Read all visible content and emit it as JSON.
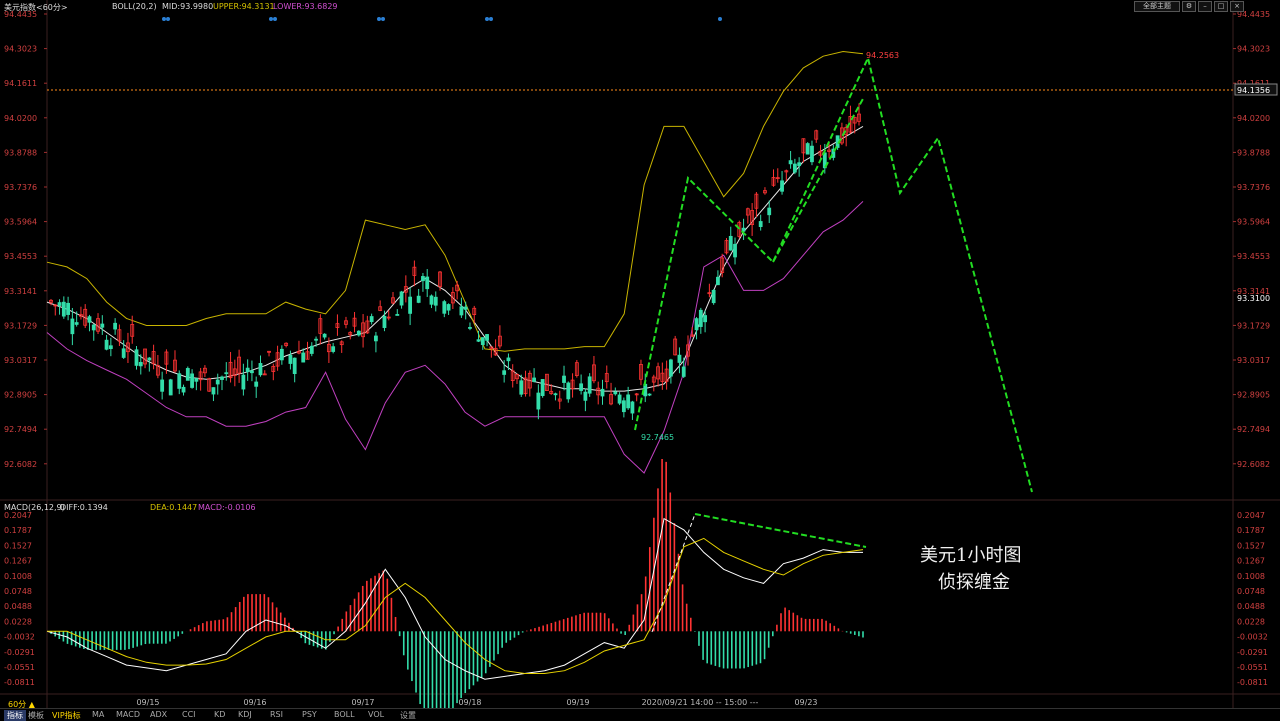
{
  "header": {
    "symbol": "美元指数<60分>",
    "boll": "BOLL(20,2)",
    "mid": "MID:93.9980",
    "upper": "UPPER:94.3131",
    "lower": "LOWER:93.6829",
    "macd": "MACD(26,12,9)",
    "diff": "DIFF:0.1394",
    "dea": "DEA:0.1447",
    "macd_val": "MACD:-0.0106",
    "main_menu": "全部主题"
  },
  "colors": {
    "up": "#ff3333",
    "down": "#33ddaa",
    "mid": "#e8e8e8",
    "upper": "#c8b400",
    "lower": "#c040c0",
    "diff": "#ffffff",
    "dea": "#e6d200",
    "forecast": "#22dd22",
    "price_label": "#ff4040",
    "current_price": "#ff8c1a"
  },
  "price_axis": [
    "94.4435",
    "94.3023",
    "94.1611",
    "94.0200",
    "93.8788",
    "93.7376",
    "93.5964",
    "93.4553",
    "93.3141",
    "93.1729",
    "93.0317",
    "92.8905",
    "92.7494",
    "92.6082"
  ],
  "macd_axis": [
    "0.2047",
    "0.1787",
    "0.1527",
    "0.1267",
    "0.1008",
    "0.0748",
    "0.0488",
    "0.0228",
    "-0.0032",
    "-0.0291",
    "-0.0551",
    "-0.0811"
  ],
  "current_price": "94.1356",
  "right_price_label": "93.3100",
  "high_label": "94.2563",
  "low_label": "92.7465",
  "dates": [
    "09/15",
    "09/16",
    "09/17",
    "09/18",
    "09/19",
    "2020/09/21 14:00 -- 15:00 ---",
    "09/23"
  ],
  "annotation": {
    "line1": "美元1小时图",
    "line2": "侦探缠金"
  },
  "bottom_tabs": [
    "指标",
    "模板",
    "VIP指标",
    "MA",
    "MACD",
    "ADX",
    "CCI",
    "KD",
    "KDJ",
    "RSI",
    "PSY",
    "BOLL",
    "VOL",
    "设置"
  ],
  "period_label": "60分 ▲",
  "chart_data": {
    "type": "candlestick",
    "series": [
      {
        "name": "BOLL MID",
        "values": [
          93.25,
          93.22,
          93.18,
          93.12,
          93.06,
          93.0,
          92.96,
          92.93,
          92.92,
          92.93,
          92.95,
          92.98,
          93.02,
          93.05,
          93.08,
          93.1,
          93.12,
          93.2,
          93.3,
          93.35,
          93.3,
          93.22,
          93.1,
          92.98,
          92.92,
          92.9,
          92.88,
          92.88,
          92.87,
          92.87,
          92.88,
          92.9,
          93.0,
          93.2,
          93.4,
          93.55,
          93.65,
          93.75,
          93.85,
          93.9,
          93.95,
          94.0
        ]
      },
      {
        "name": "BOLL UPPER",
        "values": [
          93.42,
          93.4,
          93.35,
          93.25,
          93.18,
          93.15,
          93.15,
          93.15,
          93.18,
          93.2,
          93.2,
          93.2,
          93.25,
          93.22,
          93.2,
          93.3,
          93.6,
          93.58,
          93.56,
          93.58,
          93.45,
          93.25,
          93.05,
          93.04,
          93.05,
          93.05,
          93.05,
          93.06,
          93.06,
          93.2,
          93.75,
          94.0,
          94.0,
          93.85,
          93.7,
          93.8,
          94.0,
          94.15,
          94.25,
          94.3,
          94.32,
          94.31
        ]
      },
      {
        "name": "BOLL LOWER",
        "values": [
          93.12,
          93.05,
          93.0,
          92.96,
          92.92,
          92.86,
          92.8,
          92.76,
          92.76,
          92.72,
          92.72,
          92.74,
          92.78,
          92.8,
          92.95,
          92.75,
          92.62,
          92.82,
          92.95,
          92.98,
          92.9,
          92.78,
          92.72,
          92.76,
          92.76,
          92.76,
          92.76,
          92.76,
          92.76,
          92.6,
          92.52,
          92.7,
          92.95,
          93.4,
          93.45,
          93.3,
          93.3,
          93.35,
          93.45,
          93.55,
          93.6,
          93.68
        ]
      },
      {
        "name": "DIFF",
        "values": [
          0.0,
          -0.01,
          -0.03,
          -0.045,
          -0.06,
          -0.065,
          -0.07,
          -0.06,
          -0.05,
          -0.04,
          0.0,
          0.02,
          0.01,
          -0.01,
          -0.03,
          0.0,
          0.05,
          0.11,
          0.06,
          -0.01,
          -0.05,
          -0.07,
          -0.085,
          -0.08,
          -0.075,
          -0.07,
          -0.06,
          -0.04,
          -0.02,
          -0.03,
          0.02,
          0.2,
          0.18,
          0.14,
          0.11,
          0.095,
          0.085,
          0.12,
          0.13,
          0.145,
          0.14,
          0.14
        ]
      },
      {
        "name": "DEA",
        "values": [
          0.0,
          0.0,
          -0.015,
          -0.03,
          -0.045,
          -0.055,
          -0.06,
          -0.06,
          -0.058,
          -0.05,
          -0.03,
          -0.01,
          0.0,
          0.0,
          -0.015,
          -0.015,
          0.01,
          0.06,
          0.085,
          0.06,
          0.02,
          -0.02,
          -0.05,
          -0.07,
          -0.075,
          -0.075,
          -0.07,
          -0.055,
          -0.035,
          -0.025,
          -0.015,
          0.05,
          0.15,
          0.165,
          0.14,
          0.125,
          0.11,
          0.1,
          0.12,
          0.135,
          0.14,
          0.145
        ]
      }
    ],
    "ylim": [
      92.55,
      94.48
    ],
    "macd_ylim": [
      -0.09,
      0.21
    ]
  }
}
